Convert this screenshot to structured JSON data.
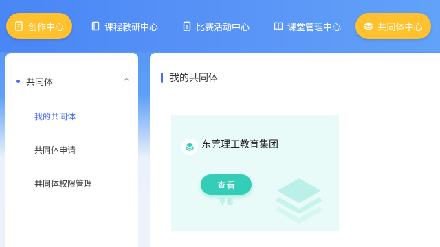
{
  "nav": {
    "items": [
      {
        "label": "创作中心",
        "icon": "document-edit-icon",
        "highlighted": true
      },
      {
        "label": "课程教研中心",
        "icon": "book-icon",
        "highlighted": false
      },
      {
        "label": "比赛活动中心",
        "icon": "clipboard-icon",
        "highlighted": false
      },
      {
        "label": "课堂管理中心",
        "icon": "open-book-icon",
        "highlighted": false
      },
      {
        "label": "共同体中心",
        "icon": "layers-icon",
        "highlighted": true
      }
    ]
  },
  "sidebar": {
    "group_label": "共同体",
    "items": [
      {
        "label": "我的共同体",
        "active": true
      },
      {
        "label": "共同体申请",
        "active": false
      },
      {
        "label": "共同体权限管理",
        "active": false
      }
    ]
  },
  "main": {
    "title": "我的共同体",
    "card": {
      "name": "东莞理工教育集团",
      "button_label": "查看"
    }
  },
  "colors": {
    "accent": "#4a6cf7",
    "highlight_pill": "#ffc12e",
    "card_bg": "#e9fbf8",
    "button": "#34cdb8"
  }
}
